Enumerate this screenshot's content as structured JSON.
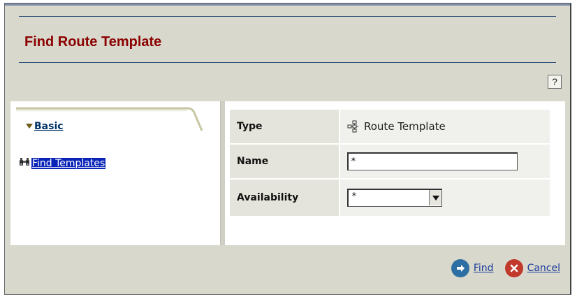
{
  "window": {
    "title": "Find Route Template",
    "help_label": "?"
  },
  "nav": {
    "section_label": "Basic",
    "item_label": "Find Templates",
    "item_icon": "binoculars-icon"
  },
  "form": {
    "type": {
      "label": "Type",
      "value": "Route Template",
      "icon": "route-template-icon"
    },
    "name": {
      "label": "Name",
      "value": "*"
    },
    "availability": {
      "label": "Availability",
      "value": "*"
    }
  },
  "actions": {
    "find_label": "Find",
    "cancel_label": "Cancel"
  },
  "colors": {
    "title": "#8b0000",
    "link": "#1a3b9a",
    "find_button": "#2e6fa3",
    "cancel_button": "#c0392b"
  }
}
